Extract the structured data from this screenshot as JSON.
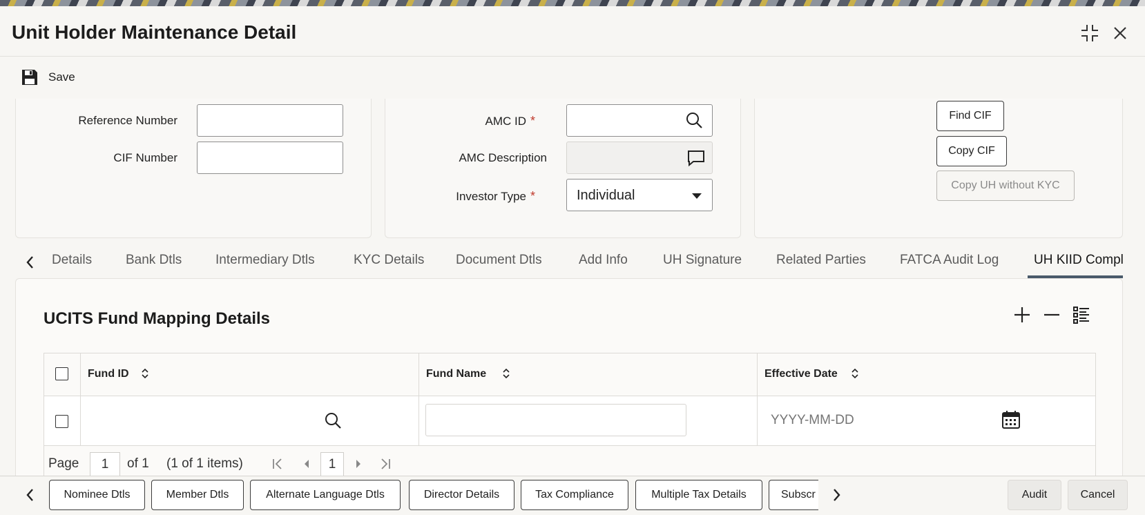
{
  "window": {
    "title": "Unit Holder Maintenance Detail"
  },
  "toolbar": {
    "save_label": "Save"
  },
  "form": {
    "reference_number_label": "Reference Number",
    "reference_number_value": "",
    "cif_number_label": "CIF Number",
    "cif_number_value": "",
    "amc_id_label": "AMC ID",
    "amc_id_value": "",
    "amc_description_label": "AMC Description",
    "amc_description_value": "",
    "investor_type_label": "Investor Type",
    "investor_type_value": "Individual",
    "required_mark": "*",
    "find_cif_label": "Find CIF",
    "copy_cif_label": "Copy CIF",
    "copy_uh_label": "Copy UH without KYC"
  },
  "tabs": [
    {
      "label": "Details"
    },
    {
      "label": "Bank Dtls"
    },
    {
      "label": "Intermediary Dtls"
    },
    {
      "label": "KYC Details"
    },
    {
      "label": "Document Dtls"
    },
    {
      "label": "Add Info"
    },
    {
      "label": "UH Signature"
    },
    {
      "label": "Related Parties"
    },
    {
      "label": "FATCA Audit Log"
    },
    {
      "label": "UH KIID Compl"
    }
  ],
  "section": {
    "title": "UCITS Fund Mapping Details"
  },
  "grid": {
    "columns": [
      "Fund ID",
      "Fund Name",
      "Effective Date"
    ],
    "row": {
      "fund_id": "",
      "fund_name": "",
      "effective_date_placeholder": "YYYY-MM-DD"
    },
    "pager": {
      "page_label": "Page",
      "page_value": "1",
      "of_label": "of 1",
      "items_label": "(1 of 1 items)",
      "current_page": "1"
    }
  },
  "footer": {
    "buttons": [
      {
        "label": "Nominee Dtls"
      },
      {
        "label": "Member Dtls"
      },
      {
        "label": "Alternate Language Dtls"
      },
      {
        "label": "Director Details"
      },
      {
        "label": "Tax Compliance"
      },
      {
        "label": "Multiple Tax Details"
      },
      {
        "label": "Subscr"
      }
    ],
    "audit_label": "Audit",
    "cancel_label": "Cancel"
  }
}
